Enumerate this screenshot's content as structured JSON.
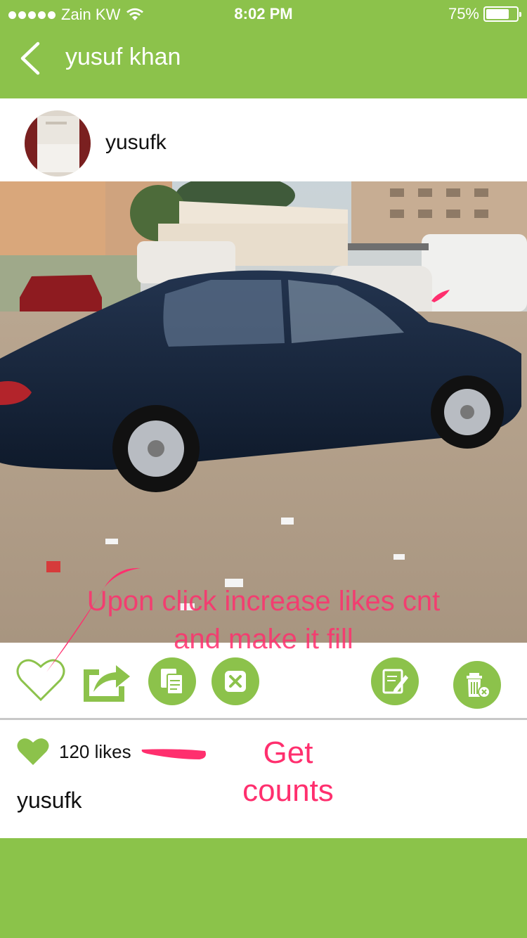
{
  "status_bar": {
    "carrier": "Zain KW",
    "time": "8:02 PM",
    "battery_percent": "75%",
    "battery_level": 0.75,
    "signal_bars": 5
  },
  "nav": {
    "title": "yusuf khan",
    "back_icon": "chevron-left-icon"
  },
  "post": {
    "username": "yusufk",
    "likes_text": "120 likes",
    "caption_username": "yusufk"
  },
  "actions": [
    {
      "icon": "heart-outline-icon"
    },
    {
      "icon": "share-icon"
    },
    {
      "icon": "copy-icon"
    },
    {
      "icon": "report-icon"
    },
    {
      "icon": "edit-icon"
    },
    {
      "icon": "delete-icon"
    }
  ],
  "annotations": {
    "like_note_line1": "Upon click increase likes cnt",
    "like_note_line2": "and make it fill",
    "count_note_line1": "Get",
    "count_note_line2": "counts"
  },
  "colors": {
    "brand_green": "#8cc24b",
    "annotation_pink": "#ff2f6e"
  }
}
